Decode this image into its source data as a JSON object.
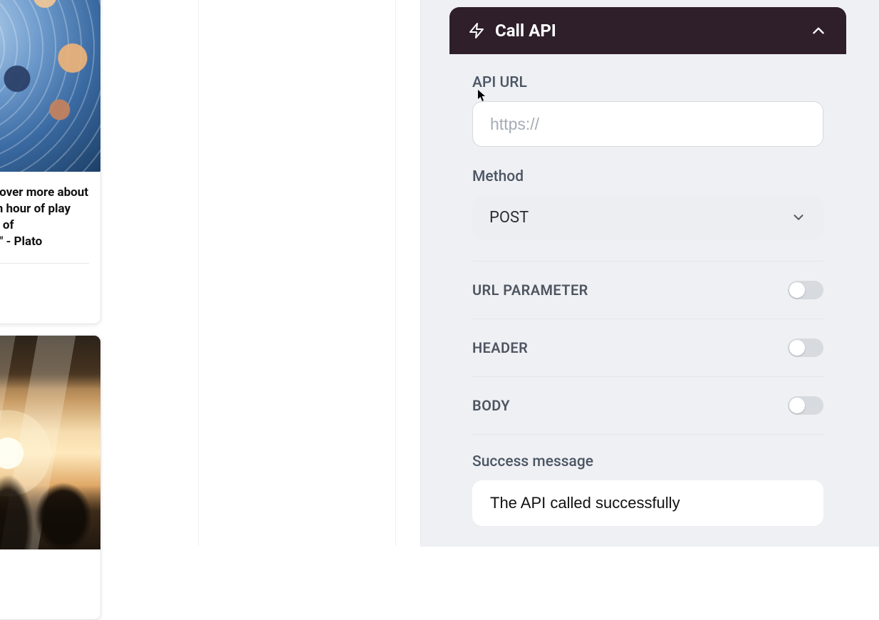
{
  "left": {
    "card1": {
      "quote": "\"You can discover more about a person in an hour of play than in a year of conversation.\" - Plato"
    }
  },
  "panel": {
    "title": "Call API",
    "api_url": {
      "label": "API URL",
      "placeholder": "https://",
      "value": ""
    },
    "method": {
      "label": "Method",
      "value": "POST"
    },
    "toggles": {
      "url_parameter": {
        "label": "URL PARAMETER",
        "on": false
      },
      "header": {
        "label": "HEADER",
        "on": false
      },
      "body": {
        "label": "BODY",
        "on": false
      }
    },
    "success": {
      "label": "Success message",
      "value": "The API called successfully"
    }
  }
}
